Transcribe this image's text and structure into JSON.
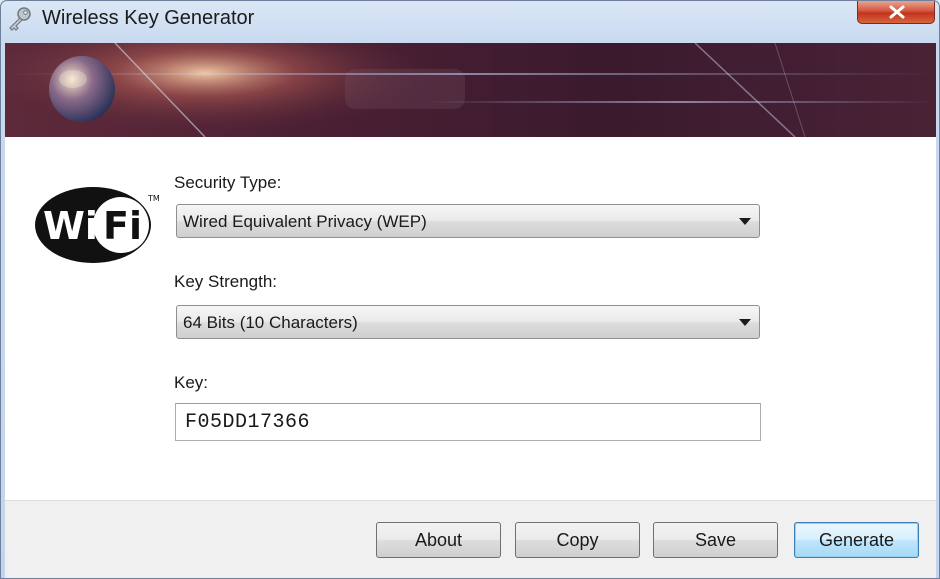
{
  "window": {
    "title": "Wireless Key Generator",
    "close_label": "Close"
  },
  "logo": {
    "text": "Wi Fi"
  },
  "form": {
    "security_type": {
      "label": "Security Type:",
      "value": "Wired Equivalent Privacy (WEP)"
    },
    "key_strength": {
      "label": "Key Strength:",
      "value": "64 Bits (10 Characters)"
    },
    "key": {
      "label": "Key:",
      "value": "F05DD17366"
    }
  },
  "buttons": {
    "about": "About",
    "copy": "Copy",
    "save": "Save",
    "generate": "Generate"
  },
  "colors": {
    "banner": "#4a1f33",
    "close_button": "#c2331c",
    "default_button_border": "#3c7fb1"
  }
}
